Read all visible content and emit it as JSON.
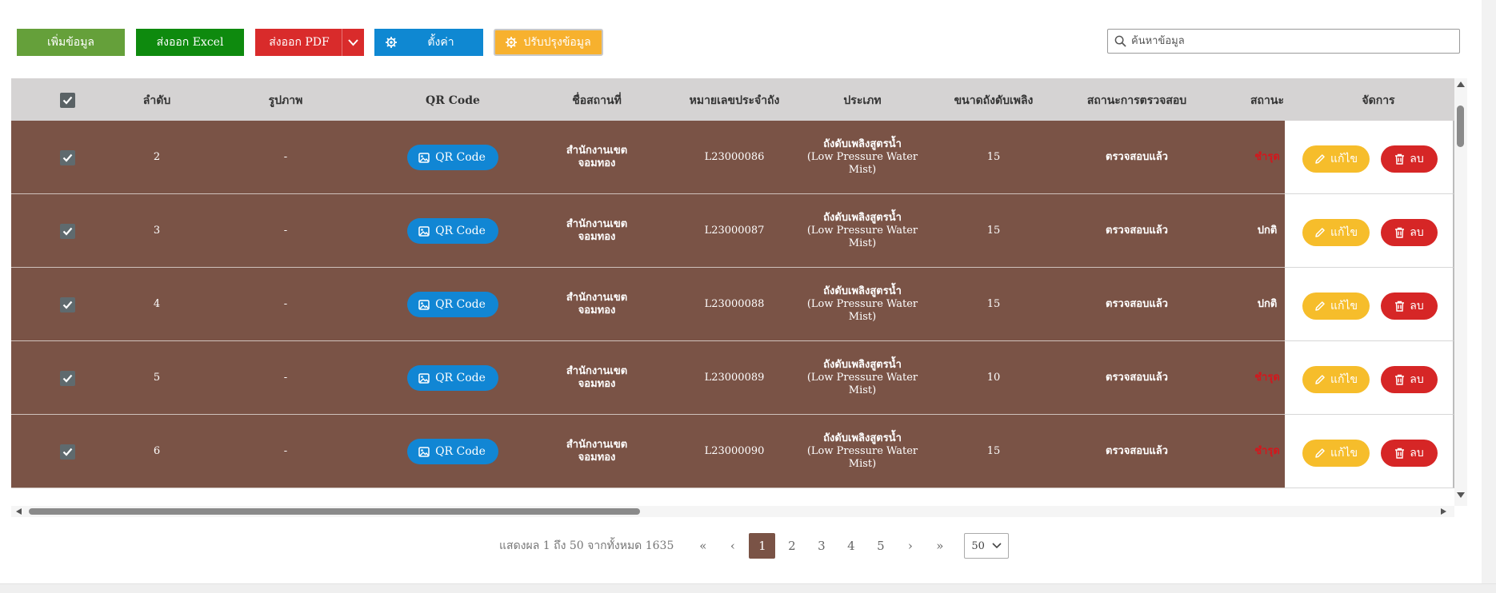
{
  "toolbar": {
    "add_label": "เพิ่มข้อมูล",
    "excel_label": "ส่งออก Excel",
    "pdf_label": "ส่งออก PDF",
    "settings_label": "ตั้งค่า",
    "update_label": "ปรับปรุงข้อมูล"
  },
  "search": {
    "placeholder": "ค้นหาข้อมูล"
  },
  "table": {
    "headers": [
      "ลำดับ",
      "รูปภาพ",
      "QR Code",
      "ชื่อสถานที่",
      "หมายเลขประจำถัง",
      "ประเภท",
      "ขนาดถังดับเพลิง",
      "สถานะการตรวจสอบ",
      "สถานะ",
      "จัดการ"
    ],
    "qr_label": "QR Code",
    "edit_label": "แก้ไข",
    "delete_label": "ลบ",
    "rows": [
      {
        "no": "2",
        "image": "-",
        "place_l1": "สำนักงานเขต",
        "place_l2": "จอมทอง",
        "tank_no": "L23000086",
        "type_l1": "ถังดับเพลิงสูตรน้ำ",
        "type_l2": "(Low Pressure Water",
        "type_l3": "Mist)",
        "size": "15",
        "inspection": "ตรวจสอบแล้ว",
        "status": "ชำรุด",
        "status_color": "#d4161c"
      },
      {
        "no": "3",
        "image": "-",
        "place_l1": "สำนักงานเขต",
        "place_l2": "จอมทอง",
        "tank_no": "L23000087",
        "type_l1": "ถังดับเพลิงสูตรน้ำ",
        "type_l2": "(Low Pressure Water",
        "type_l3": "Mist)",
        "size": "15",
        "inspection": "ตรวจสอบแล้ว",
        "status": "ปกติ",
        "status_color": "#ffffff"
      },
      {
        "no": "4",
        "image": "-",
        "place_l1": "สำนักงานเขต",
        "place_l2": "จอมทอง",
        "tank_no": "L23000088",
        "type_l1": "ถังดับเพลิงสูตรน้ำ",
        "type_l2": "(Low Pressure Water",
        "type_l3": "Mist)",
        "size": "15",
        "inspection": "ตรวจสอบแล้ว",
        "status": "ปกติ",
        "status_color": "#ffffff"
      },
      {
        "no": "5",
        "image": "-",
        "place_l1": "สำนักงานเขต",
        "place_l2": "จอมทอง",
        "tank_no": "L23000089",
        "type_l1": "ถังดับเพลิงสูตรน้ำ",
        "type_l2": "(Low Pressure Water",
        "type_l3": "Mist)",
        "size": "10",
        "inspection": "ตรวจสอบแล้ว",
        "status": "ชำรุด",
        "status_color": "#d4161c"
      },
      {
        "no": "6",
        "image": "-",
        "place_l1": "สำนักงานเขต",
        "place_l2": "จอมทอง",
        "tank_no": "L23000090",
        "type_l1": "ถังดับเพลิงสูตรน้ำ",
        "type_l2": "(Low Pressure Water",
        "type_l3": "Mist)",
        "size": "15",
        "inspection": "ตรวจสอบแล้ว",
        "status": "ชำรุด",
        "status_color": "#d4161c"
      }
    ]
  },
  "pagination": {
    "info": "แสดงผล 1 ถึง 50 จากทั้งหมด 1635",
    "first": "«",
    "prev": "‹",
    "pages": [
      "1",
      "2",
      "3",
      "4",
      "5"
    ],
    "active_page": "1",
    "next": "›",
    "last": "»",
    "page_size": "50"
  },
  "colors": {
    "row_bg": "#7a5346",
    "add": "#65a03a",
    "excel": "#0e8a0e",
    "pdf": "#d92b2b",
    "settings": "#0f88d2",
    "update": "#f7b12e",
    "edit": "#f6bd2b",
    "delete": "#d62626",
    "qr": "#1186d4"
  },
  "icons": {
    "gear": "gear-icon",
    "chevron": "chevron-down-icon",
    "search": "search-icon",
    "image": "image-icon",
    "pencil": "pencil-icon",
    "trash": "trash-icon",
    "check": "check-icon"
  }
}
